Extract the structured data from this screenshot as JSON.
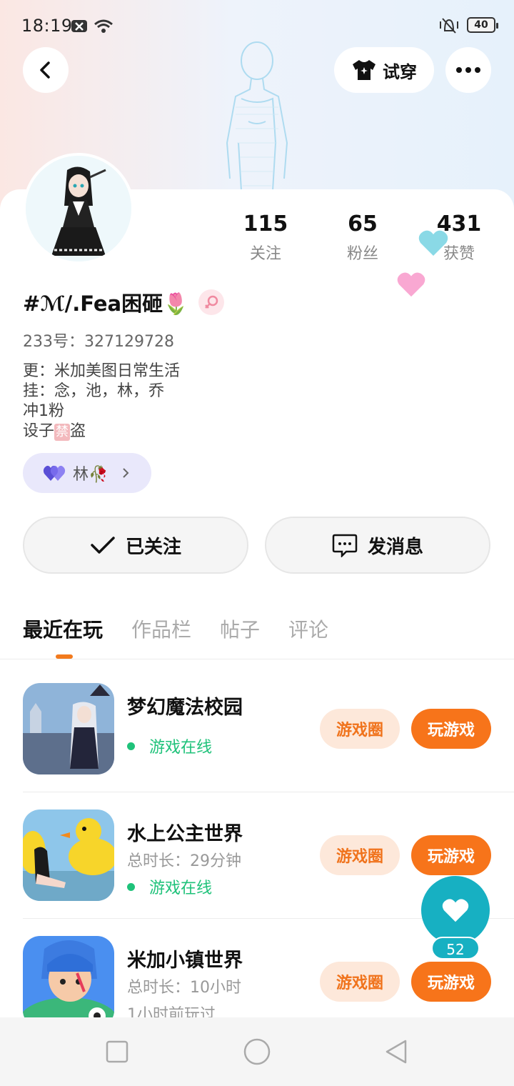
{
  "status_bar": {
    "time": "18:19",
    "battery": "40"
  },
  "header": {
    "try_on_label": "试穿"
  },
  "profile": {
    "stats": [
      {
        "value": "115",
        "label": "关注"
      },
      {
        "value": "65",
        "label": "粉丝"
      },
      {
        "value": "431",
        "label": "获赞"
      }
    ],
    "name": "#ℳ/.Fea困砸🌷",
    "uid": "233号：327129728",
    "bio": {
      "line1": "更：米加美图日常生活",
      "line2": "挂：念，池，林，乔",
      "line3": "冲1粉",
      "line4_prefix": "设子",
      "line4_mark": "禁",
      "line4_suffix": "盗"
    },
    "cp_chip": {
      "name": "林🥀"
    }
  },
  "actions": {
    "follow_label": "已关注",
    "message_label": "发消息"
  },
  "tabs": [
    {
      "label": "最近在玩",
      "active": true
    },
    {
      "label": "作品栏",
      "active": false
    },
    {
      "label": "帖子",
      "active": false
    },
    {
      "label": "评论",
      "active": false
    }
  ],
  "games": [
    {
      "title": "梦幻魔法校园",
      "duration": "",
      "last_played": "",
      "online": "游戏在线",
      "circle_label": "游戏圈",
      "play_label": "玩游戏"
    },
    {
      "title": "水上公主世界",
      "duration": "总时长：29分钟",
      "last_played": "",
      "online": "游戏在线",
      "circle_label": "游戏圈",
      "play_label": "玩游戏"
    },
    {
      "title": "米加小镇世界",
      "duration": "总时长：10小时",
      "last_played": "1小时前玩过",
      "online": "",
      "circle_label": "游戏圈",
      "play_label": "玩游戏"
    }
  ],
  "like_fab": {
    "count": "52"
  },
  "colors": {
    "accent": "#f7741a",
    "online": "#1fc27a",
    "fab": "#17b0c2"
  }
}
